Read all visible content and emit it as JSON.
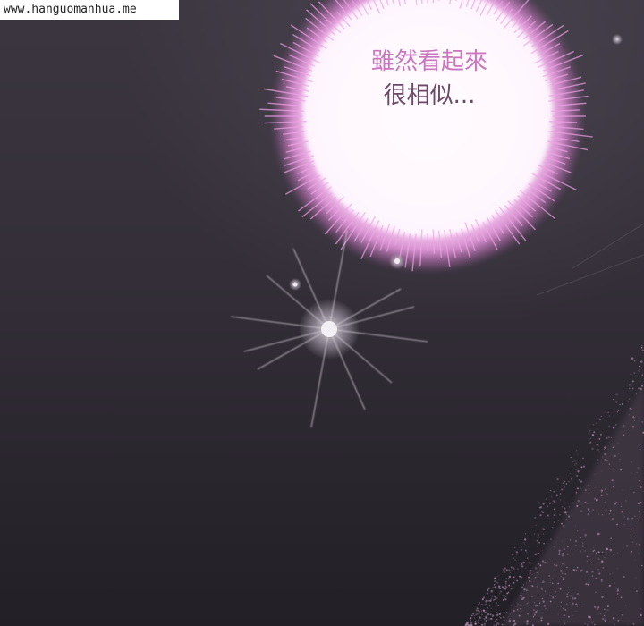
{
  "watermark": {
    "text": "www.hanguomanhua.me"
  },
  "dialogue": {
    "line1": "雖然看起來",
    "line2": "很相似..."
  },
  "colors": {
    "glow": "#f3a8ec",
    "glow_core": "#fff8ff",
    "background": "#2e2932",
    "text": "#6b4a66"
  }
}
